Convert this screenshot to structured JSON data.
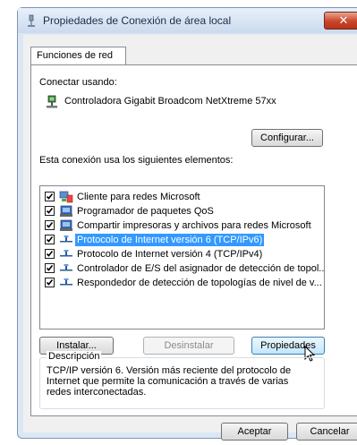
{
  "window": {
    "title": "Propiedades de Conexión de área local",
    "close_label": "✕"
  },
  "tabs": [
    {
      "label": "Funciones de red"
    }
  ],
  "connect_using": {
    "label": "Conectar usando:",
    "adapter": "Controladora Gigabit Broadcom NetXtreme 57xx",
    "configure_button": "Configurar..."
  },
  "elements": {
    "label": "Esta conexión usa los siguientes elementos:",
    "items": [
      {
        "label": "Cliente para redes Microsoft",
        "checked": true,
        "selected": false,
        "icon": "network-client-icon"
      },
      {
        "label": "Programador de paquetes QoS",
        "checked": true,
        "selected": false,
        "icon": "service-icon"
      },
      {
        "label": "Compartir impresoras y archivos para redes Microsoft",
        "checked": true,
        "selected": false,
        "icon": "service-icon"
      },
      {
        "label": "Protocolo de Internet versión 6 (TCP/IPv6)",
        "checked": true,
        "selected": true,
        "icon": "protocol-icon"
      },
      {
        "label": "Protocolo de Internet versión 4 (TCP/IPv4)",
        "checked": true,
        "selected": false,
        "icon": "protocol-icon"
      },
      {
        "label": "Controlador de E/S del asignador de detección de topol...",
        "checked": true,
        "selected": false,
        "icon": "protocol-icon"
      },
      {
        "label": "Respondedor de detección de topologías de nivel de v...",
        "checked": true,
        "selected": false,
        "icon": "protocol-icon"
      }
    ]
  },
  "buttons": {
    "install": "Instalar...",
    "uninstall": "Desinstalar",
    "properties": "Propiedades"
  },
  "description": {
    "legend": "Descripción",
    "text": "TCP/IP versión 6. Versión más reciente del protocolo de Internet que permite la comunicación a través de varias redes interconectadas."
  },
  "dialog_buttons": {
    "ok": "Aceptar",
    "cancel": "Cancelar"
  }
}
